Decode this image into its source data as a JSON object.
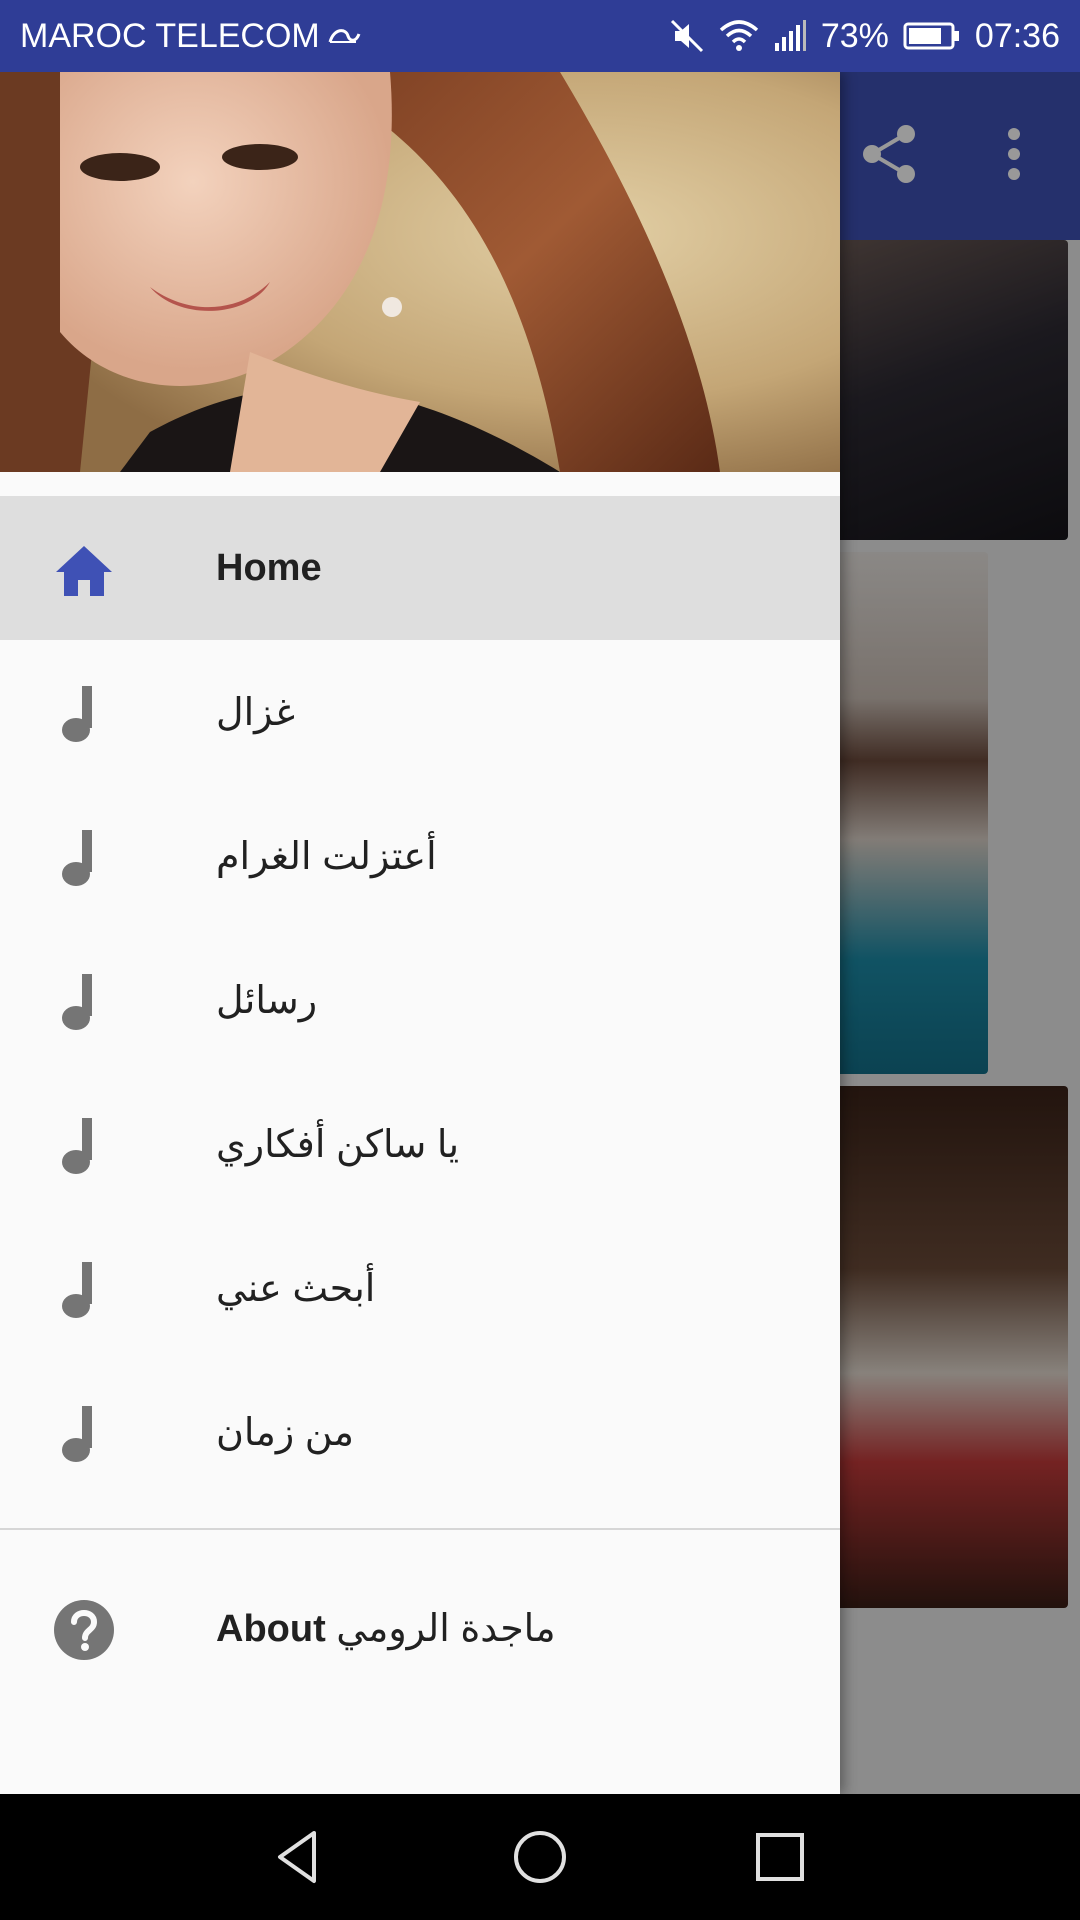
{
  "status_bar": {
    "carrier": "MAROC TELECOM",
    "battery_percent": "73%",
    "time": "07:36"
  },
  "app_bar": {
    "share_icon": "share-icon",
    "overflow_icon": "more-vert-icon",
    "color": "#3f51b5"
  },
  "drawer": {
    "header_image": "singer-portrait",
    "items": [
      {
        "label": "Home",
        "icon": "home-icon",
        "active": true
      },
      {
        "label": "غزال",
        "icon": "music-note-icon"
      },
      {
        "label": "أعتزلت الغرام",
        "icon": "music-note-icon"
      },
      {
        "label": "رسائل",
        "icon": "music-note-icon"
      },
      {
        "label": "يا ساكن أفكاري",
        "icon": "music-note-icon"
      },
      {
        "label": "أبحث عني",
        "icon": "music-note-icon"
      },
      {
        "label": "من زمان",
        "icon": "music-note-icon"
      }
    ],
    "about": {
      "label_en": "About",
      "label_ar": "ماجدة الرومي",
      "icon": "help-icon"
    }
  },
  "colors": {
    "status_bar": "#2f3d96",
    "accent": "#3f51b5",
    "icon_grey": "#757575"
  }
}
